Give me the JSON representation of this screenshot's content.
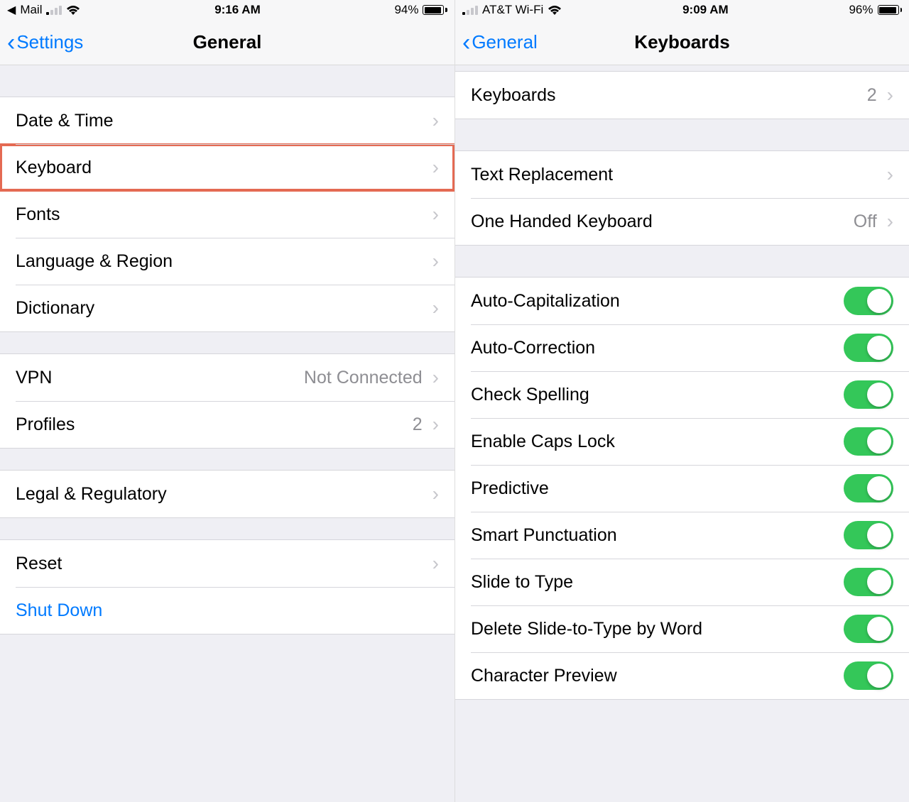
{
  "left": {
    "status": {
      "appReturn": "Mail",
      "time": "9:16 AM",
      "batteryPct": "94%",
      "batteryFill": 94,
      "signalActive": 1
    },
    "nav": {
      "back": "Settings",
      "title": "General"
    },
    "group1": [
      {
        "key": "datetime",
        "label": "Date & Time"
      },
      {
        "key": "keyboard",
        "label": "Keyboard",
        "highlight": true
      },
      {
        "key": "fonts",
        "label": "Fonts"
      },
      {
        "key": "langregion",
        "label": "Language & Region"
      },
      {
        "key": "dictionary",
        "label": "Dictionary"
      }
    ],
    "group2": [
      {
        "key": "vpn",
        "label": "VPN",
        "detail": "Not Connected"
      },
      {
        "key": "profiles",
        "label": "Profiles",
        "detail": "2"
      }
    ],
    "group3": [
      {
        "key": "legal",
        "label": "Legal & Regulatory"
      }
    ],
    "group4": [
      {
        "key": "reset",
        "label": "Reset"
      },
      {
        "key": "shutdown",
        "label": "Shut Down",
        "action": true,
        "noChevron": true
      }
    ]
  },
  "right": {
    "status": {
      "carrier": "AT&T Wi-Fi",
      "time": "9:09 AM",
      "batteryPct": "96%",
      "batteryFill": 96,
      "signalActive": 1
    },
    "nav": {
      "back": "General",
      "title": "Keyboards"
    },
    "group1": [
      {
        "key": "keyboards",
        "label": "Keyboards",
        "detail": "2"
      }
    ],
    "group2": [
      {
        "key": "textrepl",
        "label": "Text Replacement"
      },
      {
        "key": "onehand",
        "label": "One Handed Keyboard",
        "detail": "Off"
      }
    ],
    "toggles": [
      {
        "key": "autocap",
        "label": "Auto-Capitalization",
        "on": true
      },
      {
        "key": "autocorrect",
        "label": "Auto-Correction",
        "on": true
      },
      {
        "key": "spelling",
        "label": "Check Spelling",
        "on": true
      },
      {
        "key": "capslock",
        "label": "Enable Caps Lock",
        "on": true
      },
      {
        "key": "predictive",
        "label": "Predictive",
        "on": true
      },
      {
        "key": "smartpunct",
        "label": "Smart Punctuation",
        "on": true
      },
      {
        "key": "slidetype",
        "label": "Slide to Type",
        "on": true
      },
      {
        "key": "delslide",
        "label": "Delete Slide-to-Type by Word",
        "on": true
      },
      {
        "key": "charpreview",
        "label": "Character Preview",
        "on": true
      }
    ]
  }
}
